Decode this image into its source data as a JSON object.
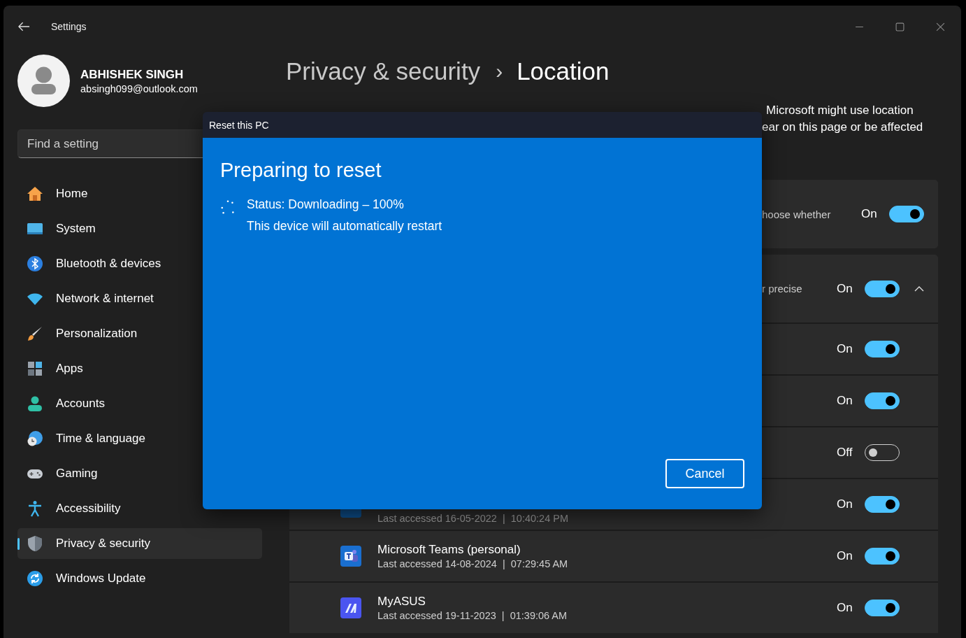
{
  "window": {
    "title": "Settings"
  },
  "user": {
    "name": "ABHISHEK SINGH",
    "email": "absingh099@outlook.com"
  },
  "search": {
    "placeholder": "Find a setting"
  },
  "nav": [
    {
      "label": "Home",
      "kind": "home",
      "selected": false
    },
    {
      "label": "System",
      "kind": "system",
      "selected": false
    },
    {
      "label": "Bluetooth & devices",
      "kind": "bluetooth",
      "selected": false
    },
    {
      "label": "Network & internet",
      "kind": "network",
      "selected": false
    },
    {
      "label": "Personalization",
      "kind": "brush",
      "selected": false
    },
    {
      "label": "Apps",
      "kind": "apps",
      "selected": false
    },
    {
      "label": "Accounts",
      "kind": "accounts",
      "selected": false
    },
    {
      "label": "Time & language",
      "kind": "time",
      "selected": false
    },
    {
      "label": "Gaming",
      "kind": "gaming",
      "selected": false
    },
    {
      "label": "Accessibility",
      "kind": "accessibility",
      "selected": false
    },
    {
      "label": "Privacy & security",
      "kind": "shield",
      "selected": true
    },
    {
      "label": "Windows Update",
      "kind": "update",
      "selected": false
    }
  ],
  "breadcrumb": {
    "parent": "Privacy & security",
    "separator": "›",
    "current": "Location"
  },
  "description_lines": [
    "Microsoft might use location",
    "ear on this page or be affected"
  ],
  "settings": [
    {
      "text": "hoose whether",
      "state": "On",
      "on": true
    },
    {
      "text": "r precise",
      "state": "On",
      "on": true,
      "expanded": true
    }
  ],
  "apps": [
    {
      "state": "On",
      "on": true
    },
    {
      "state": "On",
      "on": true
    },
    {
      "state": "Off",
      "on": false
    },
    {
      "kind": "generic",
      "accessed": "Last accessed 16-05-2022  |  10:40:24 PM",
      "state": "On",
      "on": true
    },
    {
      "kind": "teams",
      "name": "Microsoft Teams (personal)",
      "accessed": "Last accessed 14-08-2024  |  07:29:45 AM",
      "state": "On",
      "on": true
    },
    {
      "kind": "myasus",
      "name": "MyASUS",
      "accessed": "Last accessed 19-11-2023  |  01:39:06 AM",
      "state": "On",
      "on": true
    }
  ],
  "dialog": {
    "title": "Reset this PC",
    "heading": "Preparing to reset",
    "status": "Status: Downloading – 100%",
    "note": "This device will automatically restart",
    "button": "Cancel"
  }
}
